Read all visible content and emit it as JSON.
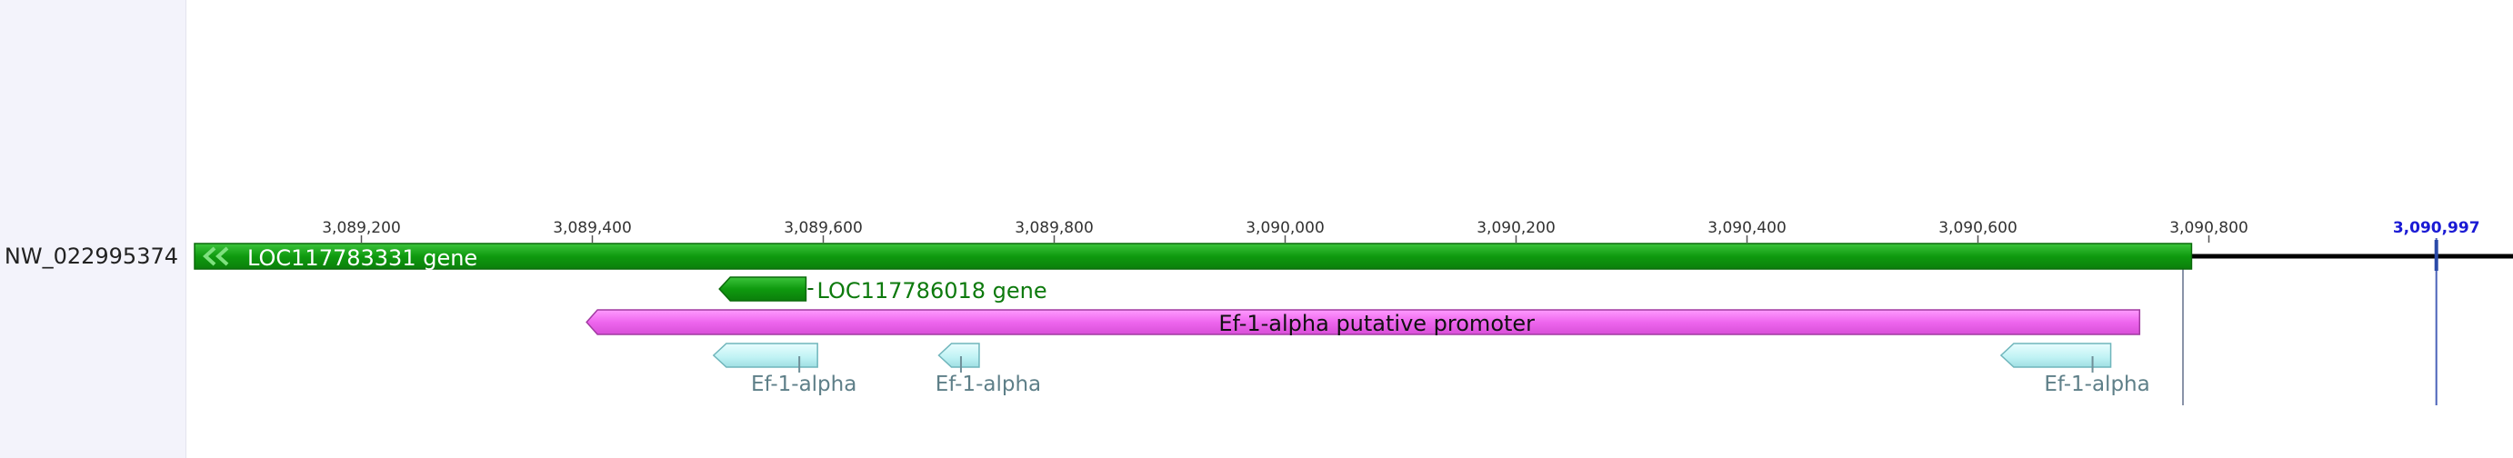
{
  "sequence": {
    "name": "NW_022995374"
  },
  "ruler": {
    "ticks": [
      {
        "label": "3,089,200",
        "pos": 3089200
      },
      {
        "label": "3,089,400",
        "pos": 3089400
      },
      {
        "label": "3,089,600",
        "pos": 3089600
      },
      {
        "label": "3,089,800",
        "pos": 3089800
      },
      {
        "label": "3,090,000",
        "pos": 3090000
      },
      {
        "label": "3,090,200",
        "pos": 3090200
      },
      {
        "label": "3,090,400",
        "pos": 3090400
      },
      {
        "label": "3,090,600",
        "pos": 3090600
      },
      {
        "label": "3,090,800",
        "pos": 3090800
      }
    ],
    "cursor": {
      "label": "3,090,997",
      "pos": 3090997
    }
  },
  "features": {
    "gene1": {
      "label": "LOC117783331 gene",
      "start": 3089065,
      "end": 3090785,
      "strand": "-"
    },
    "gene2": {
      "label": "LOC117786018 gene",
      "start": 3089510,
      "end": 3089585,
      "strand": "-"
    },
    "promoter": {
      "label": "Ef-1-alpha putative promoter",
      "start": 3089395,
      "end": 3090740,
      "strand": "-"
    },
    "cds": [
      {
        "label": "Ef-1-alpha",
        "start": 3089505,
        "end": 3089595,
        "strand": "-"
      },
      {
        "label": "Ef-1-alpha",
        "start": 3089700,
        "end": 3089735,
        "strand": "-"
      },
      {
        "label": "Ef-1-alpha",
        "start": 3090620,
        "end": 3090715,
        "strand": "-"
      }
    ]
  },
  "colors": {
    "gene": "#11a011",
    "promoter": "#ee66ee",
    "cds": "#bff2f4",
    "cursor": "#1a1ad4"
  }
}
